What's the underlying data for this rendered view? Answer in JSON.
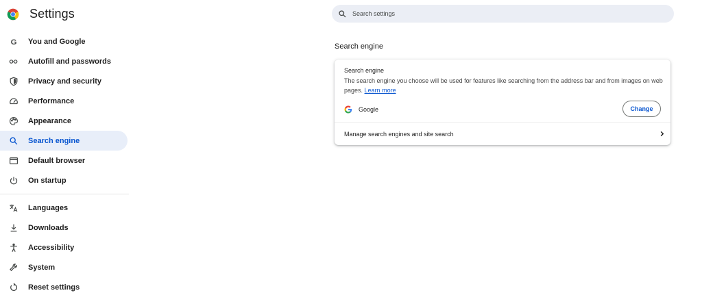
{
  "app": {
    "title": "Settings"
  },
  "search": {
    "placeholder": "Search settings",
    "icon": "search-icon"
  },
  "sidebar": {
    "items": [
      {
        "label": "You and Google",
        "icon": "google-g-icon",
        "active": false
      },
      {
        "label": "Autofill and passwords",
        "icon": "key-icon",
        "active": false
      },
      {
        "label": "Privacy and security",
        "icon": "shield-icon",
        "active": false
      },
      {
        "label": "Performance",
        "icon": "speedometer-icon",
        "active": false
      },
      {
        "label": "Appearance",
        "icon": "palette-icon",
        "active": false
      },
      {
        "label": "Search engine",
        "icon": "search-icon",
        "active": true
      },
      {
        "label": "Default browser",
        "icon": "browser-window-icon",
        "active": false
      },
      {
        "label": "On startup",
        "icon": "power-icon",
        "active": false
      },
      {
        "label": "Languages",
        "icon": "translate-icon",
        "active": false
      },
      {
        "label": "Downloads",
        "icon": "download-icon",
        "active": false
      },
      {
        "label": "Accessibility",
        "icon": "accessibility-icon",
        "active": false
      },
      {
        "label": "System",
        "icon": "wrench-icon",
        "active": false
      },
      {
        "label": "Reset settings",
        "icon": "reset-icon",
        "active": false
      }
    ]
  },
  "main": {
    "section_title": "Search engine",
    "card": {
      "title": "Search engine",
      "description": "The search engine you choose will be used for features like searching from the address bar and from images on web pages.",
      "learn_more": "Learn more",
      "engine_name": "Google",
      "change_label": "Change",
      "manage_label": "Manage search engines and site search"
    }
  },
  "colors": {
    "accent": "#0b57d0",
    "active_bg": "#e8eef9",
    "search_bg": "#ebeef5"
  }
}
